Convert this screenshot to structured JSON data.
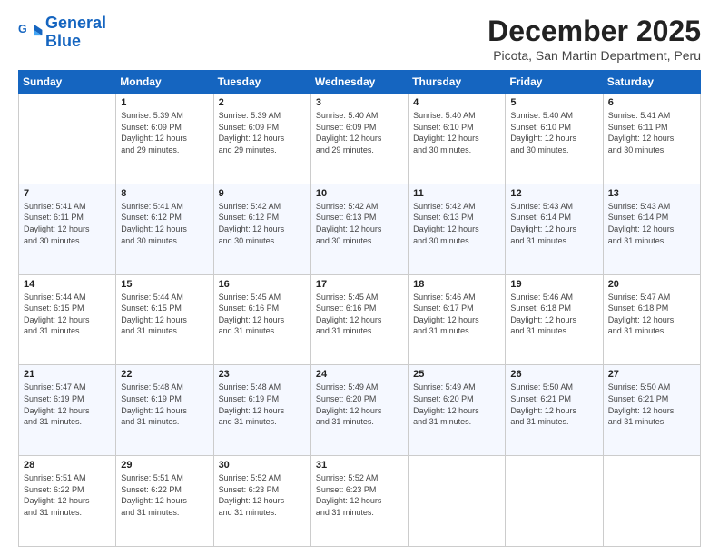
{
  "logo": {
    "line1": "General",
    "line2": "Blue"
  },
  "title": "December 2025",
  "subtitle": "Picota, San Martin Department, Peru",
  "days_of_week": [
    "Sunday",
    "Monday",
    "Tuesday",
    "Wednesday",
    "Thursday",
    "Friday",
    "Saturday"
  ],
  "weeks": [
    [
      {
        "day": "",
        "info": ""
      },
      {
        "day": "1",
        "info": "Sunrise: 5:39 AM\nSunset: 6:09 PM\nDaylight: 12 hours\nand 29 minutes."
      },
      {
        "day": "2",
        "info": "Sunrise: 5:39 AM\nSunset: 6:09 PM\nDaylight: 12 hours\nand 29 minutes."
      },
      {
        "day": "3",
        "info": "Sunrise: 5:40 AM\nSunset: 6:09 PM\nDaylight: 12 hours\nand 29 minutes."
      },
      {
        "day": "4",
        "info": "Sunrise: 5:40 AM\nSunset: 6:10 PM\nDaylight: 12 hours\nand 30 minutes."
      },
      {
        "day": "5",
        "info": "Sunrise: 5:40 AM\nSunset: 6:10 PM\nDaylight: 12 hours\nand 30 minutes."
      },
      {
        "day": "6",
        "info": "Sunrise: 5:41 AM\nSunset: 6:11 PM\nDaylight: 12 hours\nand 30 minutes."
      }
    ],
    [
      {
        "day": "7",
        "info": "Sunrise: 5:41 AM\nSunset: 6:11 PM\nDaylight: 12 hours\nand 30 minutes."
      },
      {
        "day": "8",
        "info": "Sunrise: 5:41 AM\nSunset: 6:12 PM\nDaylight: 12 hours\nand 30 minutes."
      },
      {
        "day": "9",
        "info": "Sunrise: 5:42 AM\nSunset: 6:12 PM\nDaylight: 12 hours\nand 30 minutes."
      },
      {
        "day": "10",
        "info": "Sunrise: 5:42 AM\nSunset: 6:13 PM\nDaylight: 12 hours\nand 30 minutes."
      },
      {
        "day": "11",
        "info": "Sunrise: 5:42 AM\nSunset: 6:13 PM\nDaylight: 12 hours\nand 30 minutes."
      },
      {
        "day": "12",
        "info": "Sunrise: 5:43 AM\nSunset: 6:14 PM\nDaylight: 12 hours\nand 31 minutes."
      },
      {
        "day": "13",
        "info": "Sunrise: 5:43 AM\nSunset: 6:14 PM\nDaylight: 12 hours\nand 31 minutes."
      }
    ],
    [
      {
        "day": "14",
        "info": "Sunrise: 5:44 AM\nSunset: 6:15 PM\nDaylight: 12 hours\nand 31 minutes."
      },
      {
        "day": "15",
        "info": "Sunrise: 5:44 AM\nSunset: 6:15 PM\nDaylight: 12 hours\nand 31 minutes."
      },
      {
        "day": "16",
        "info": "Sunrise: 5:45 AM\nSunset: 6:16 PM\nDaylight: 12 hours\nand 31 minutes."
      },
      {
        "day": "17",
        "info": "Sunrise: 5:45 AM\nSunset: 6:16 PM\nDaylight: 12 hours\nand 31 minutes."
      },
      {
        "day": "18",
        "info": "Sunrise: 5:46 AM\nSunset: 6:17 PM\nDaylight: 12 hours\nand 31 minutes."
      },
      {
        "day": "19",
        "info": "Sunrise: 5:46 AM\nSunset: 6:18 PM\nDaylight: 12 hours\nand 31 minutes."
      },
      {
        "day": "20",
        "info": "Sunrise: 5:47 AM\nSunset: 6:18 PM\nDaylight: 12 hours\nand 31 minutes."
      }
    ],
    [
      {
        "day": "21",
        "info": "Sunrise: 5:47 AM\nSunset: 6:19 PM\nDaylight: 12 hours\nand 31 minutes."
      },
      {
        "day": "22",
        "info": "Sunrise: 5:48 AM\nSunset: 6:19 PM\nDaylight: 12 hours\nand 31 minutes."
      },
      {
        "day": "23",
        "info": "Sunrise: 5:48 AM\nSunset: 6:19 PM\nDaylight: 12 hours\nand 31 minutes."
      },
      {
        "day": "24",
        "info": "Sunrise: 5:49 AM\nSunset: 6:20 PM\nDaylight: 12 hours\nand 31 minutes."
      },
      {
        "day": "25",
        "info": "Sunrise: 5:49 AM\nSunset: 6:20 PM\nDaylight: 12 hours\nand 31 minutes."
      },
      {
        "day": "26",
        "info": "Sunrise: 5:50 AM\nSunset: 6:21 PM\nDaylight: 12 hours\nand 31 minutes."
      },
      {
        "day": "27",
        "info": "Sunrise: 5:50 AM\nSunset: 6:21 PM\nDaylight: 12 hours\nand 31 minutes."
      }
    ],
    [
      {
        "day": "28",
        "info": "Sunrise: 5:51 AM\nSunset: 6:22 PM\nDaylight: 12 hours\nand 31 minutes."
      },
      {
        "day": "29",
        "info": "Sunrise: 5:51 AM\nSunset: 6:22 PM\nDaylight: 12 hours\nand 31 minutes."
      },
      {
        "day": "30",
        "info": "Sunrise: 5:52 AM\nSunset: 6:23 PM\nDaylight: 12 hours\nand 31 minutes."
      },
      {
        "day": "31",
        "info": "Sunrise: 5:52 AM\nSunset: 6:23 PM\nDaylight: 12 hours\nand 31 minutes."
      },
      {
        "day": "",
        "info": ""
      },
      {
        "day": "",
        "info": ""
      },
      {
        "day": "",
        "info": ""
      }
    ]
  ]
}
